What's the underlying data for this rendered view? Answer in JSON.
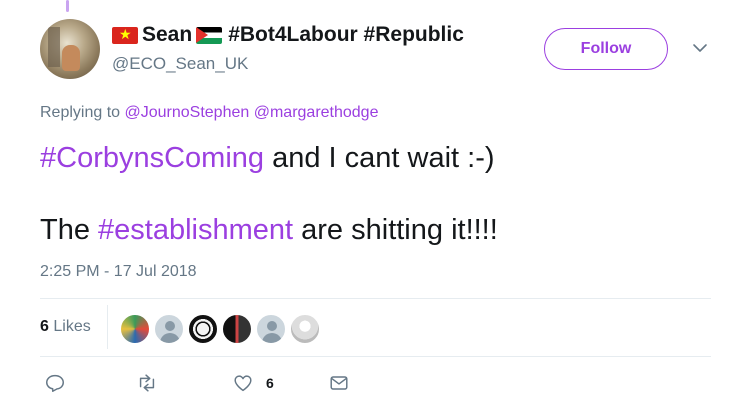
{
  "tweet": {
    "display_name": "Sean",
    "display_name_suffix": "#Bot4Labour #Republic",
    "handle": "@ECO_Sean_UK",
    "follow_label": "Follow",
    "replying_prefix": "Replying to",
    "replying_mentions": "@JournoStephen @margarethodge",
    "line1_hashtag": "#CorbynsComing",
    "line1_rest": " and I cant wait :-)",
    "line2_start": "The ",
    "line2_hashtag": "#establishment",
    "line2_rest": " are shitting it!!!!",
    "timestamp": "2:25 PM - 17 Jul 2018",
    "likes_count": "6",
    "likes_label": "Likes",
    "like_action_count": "6"
  },
  "colors": {
    "accent": "#9b3fe0",
    "secondary_text": "#657786",
    "divider": "#e6ecf0"
  },
  "icons": {
    "flag_left": "vietnam-flag-icon",
    "flag_right": "palestine-flag-icon",
    "caret": "chevron-down-icon",
    "reply": "reply-icon",
    "retweet": "retweet-icon",
    "like": "heart-icon",
    "message": "envelope-icon"
  }
}
